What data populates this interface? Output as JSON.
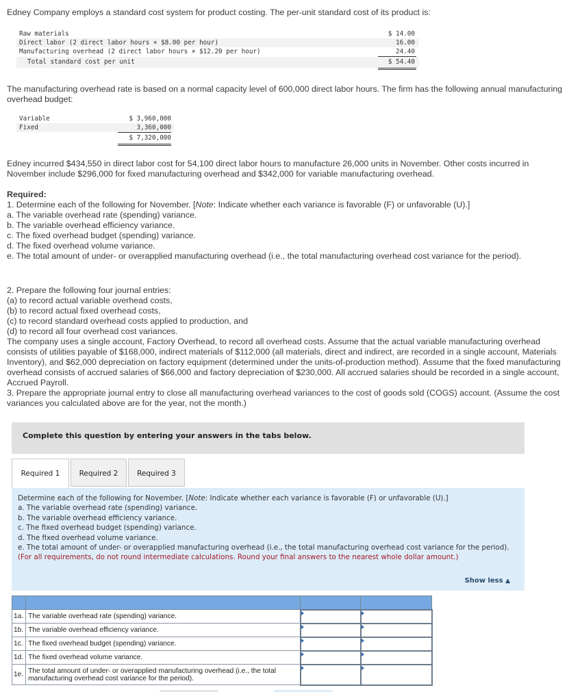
{
  "intro": "Edney Company employs a standard cost system for product costing. The per-unit standard cost of its product is:",
  "standard_cost": {
    "rows": [
      {
        "label": "Raw materials",
        "value": "$ 14.00"
      },
      {
        "label": "Direct labor (2 direct labor hours × $8.00 per hour)",
        "value": "16.00"
      },
      {
        "label": "Manufacturing overhead (2 direct labor hours × $12.20 per hour)",
        "value": "24.40"
      }
    ],
    "total_label": "Total standard cost per unit",
    "total_value": "$ 54.40"
  },
  "overhead_intro": "The manufacturing overhead rate is based on a normal capacity level of 600,000 direct labor hours. The firm has the following annual manufacturing overhead budget:",
  "budget": {
    "rows": [
      {
        "label": "Variable",
        "value": "$ 3,960,000"
      },
      {
        "label": "Fixed",
        "value": "3,360,000"
      }
    ],
    "total_value": "$ 7,320,000"
  },
  "incurred": "Edney incurred $434,550 in direct labor cost for 54,100 direct labor hours to manufacture 26,000 units in November. Other costs incurred in November include $296,000 for fixed manufacturing overhead and $342,000 for variable manufacturing overhead.",
  "required": {
    "heading": "Required:",
    "q1_pre": "1. Determine each of the following for November. [",
    "q1_note": "Note",
    "q1_post": ": Indicate whether each variance is favorable (F) or unfavorable (U).]",
    "q1_items": [
      "a. The variable overhead rate (spending) variance.",
      "b. The variable overhead efficiency variance.",
      "c. The fixed overhead budget (spending) variance.",
      "d. The fixed overhead volume variance.",
      "e. The total amount of under- or overapplied manufacturing overhead (i.e., the total manufacturing overhead cost variance for the period)."
    ],
    "q2_lines": [
      "2. Prepare the following four journal entries:",
      "(a) to record actual variable overhead costs,",
      "(b) to record actual fixed overhead costs,",
      "(c) to record standard overhead costs applied to production, and",
      "(d) to record all four overhead cost variances."
    ],
    "q2_para": "The company uses a single account, Factory Overhead, to record all overhead costs. Assume that the actual variable manufacturing overhead consists of utilities payable of $168,000, indirect materials of $112,000 (all materials, direct and indirect, are recorded in a single account, Materials Inventory), and $62,000 depreciation on factory equipment (determined under the units-of-production method). Assume that the fixed manufacturing overhead consists of accrued salaries of $66,000 and factory depreciation of $230,000. All accrued salaries should be recorded in a single account, Accrued Payroll.",
    "q3": "3. Prepare the appropriate journal entry to close all manufacturing overhead variances to the cost of goods sold (COGS) account. (Assume the cost variances you calculated above are for the year, not the month.)"
  },
  "instruction_bar": "Complete this question by entering your answers in the tabs below.",
  "tabs": [
    {
      "label": "Required 1",
      "active": true
    },
    {
      "label": "Required 2",
      "active": false
    },
    {
      "label": "Required 3",
      "active": false
    }
  ],
  "panel": {
    "line1_pre": "Determine each of the following for November. [",
    "line1_note": "Note",
    "line1_post": ": Indicate whether each variance is favorable (F) or unfavorable (U).]",
    "items": [
      "a. The variable overhead rate (spending) variance.",
      "b. The variable overhead efficiency variance.",
      "c. The fixed overhead budget (spending) variance.",
      "d. The fixed overhead volume variance.",
      "e. The total amount of under- or overapplied manufacturing overhead (i.e., the total manufacturing overhead cost variance for the period)."
    ],
    "rounding_note": "(For all requirements, do not round intermediate calculations. Round your final answers to the nearest whole dollar amount.)",
    "show_less": "Show less",
    "show_less_icon": "triangle-up-icon"
  },
  "answer_table": {
    "rows": [
      {
        "id": "1a.",
        "desc": "The variable overhead rate (spending) variance.",
        "amount": "",
        "fu": ""
      },
      {
        "id": "1b.",
        "desc": "The variable overhead efficiency variance.",
        "amount": "",
        "fu": ""
      },
      {
        "id": "1c.",
        "desc": "The fixed overhead budget (spending) variance.",
        "amount": "",
        "fu": ""
      },
      {
        "id": "1d.",
        "desc": "The fixed overhead volume variance.",
        "amount": "",
        "fu": ""
      },
      {
        "id": "1e.",
        "desc": "The total amount of under- or overapplied manufacturing overhead (i.e., the total manufacturing overhead cost variance for the period).",
        "amount": "",
        "fu": ""
      }
    ]
  },
  "colors": {
    "header_blue": "#76a9e2",
    "panel_blue": "#dcecf9",
    "instr_gray": "#e0e0e0",
    "note_red": "#a31d24",
    "link_navy": "#2d4a6a"
  }
}
